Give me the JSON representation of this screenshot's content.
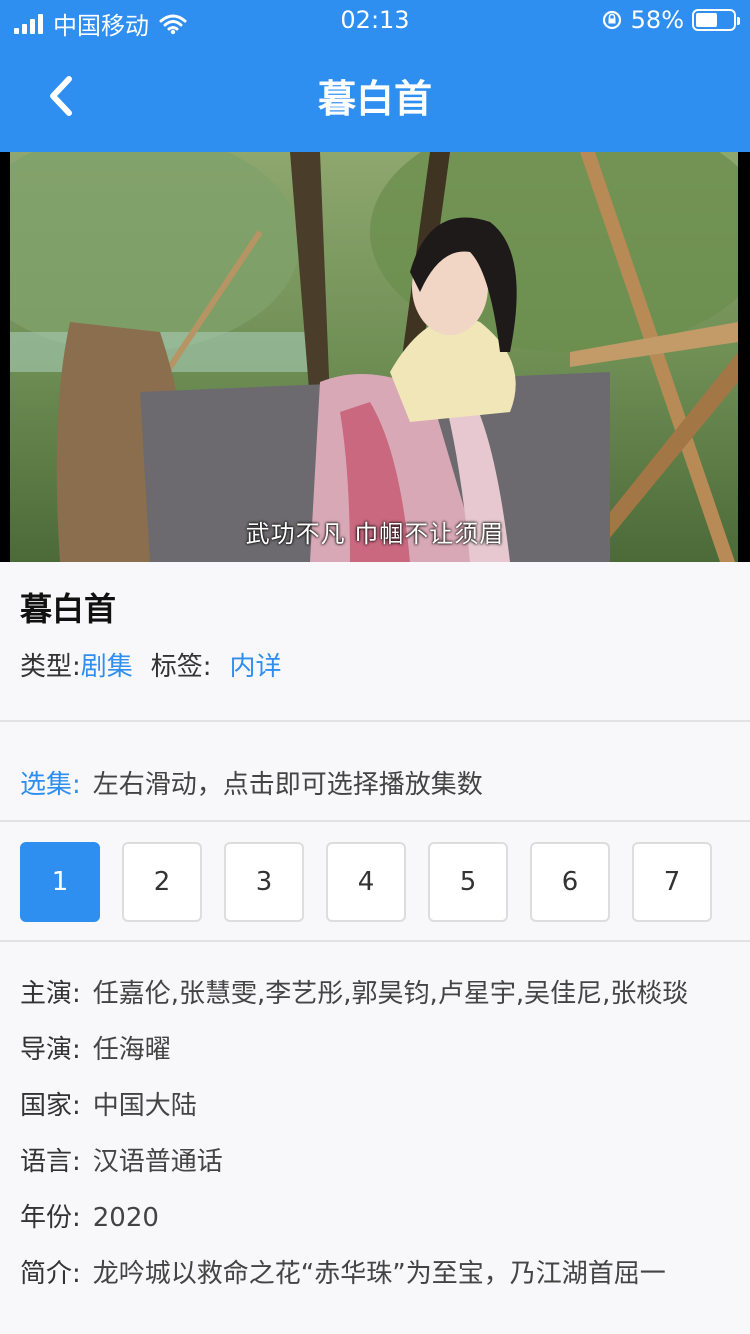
{
  "status_bar": {
    "carrier": "中国移动",
    "time": "02:13",
    "battery_percent": "58%",
    "battery_level": 0.58
  },
  "nav": {
    "title": "暮白首"
  },
  "video": {
    "subtitle": "武功不凡 巾帼不让须眉"
  },
  "show": {
    "title": "暮白首",
    "type_label": "类型:",
    "type_value": "剧集",
    "tag_label": "标签:",
    "tag_value": "内详"
  },
  "episodes": {
    "label": "选集:",
    "hint": "左右滑动，点击即可选择播放集数",
    "items": [
      "1",
      "2",
      "3",
      "4",
      "5",
      "6",
      "7"
    ],
    "selected": "1"
  },
  "info": {
    "cast_label": "主演:",
    "cast_value": "任嘉伦,张慧雯,李艺彤,郭昊钧,卢星宇,吴佳尼,张棪琰",
    "director_label": "导演:",
    "director_value": "任海曜",
    "country_label": "国家:",
    "country_value": "中国大陆",
    "language_label": "语言:",
    "language_value": "汉语普通话",
    "year_label": "年份:",
    "year_value": "2020",
    "intro_label": "简介:",
    "intro_value": "龙吟城以救命之花“赤华珠”为至宝，乃江湖首屈一"
  },
  "colors": {
    "accent": "#2e8ff0",
    "background": "#f8f7f9",
    "divider": "#e2e2e2"
  }
}
